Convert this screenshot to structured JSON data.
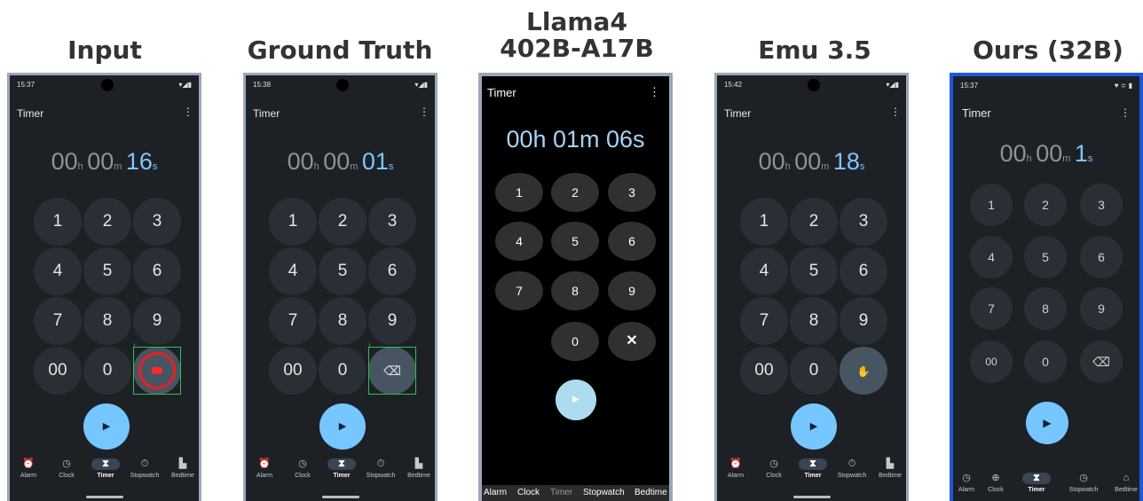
{
  "headings": [
    "Input",
    "Ground Truth",
    "Llama4\n402B-A17B",
    "Emu 3.5",
    "Ours (32B)"
  ],
  "app": {
    "title": "Timer",
    "menu_icon": "⋮",
    "play_icon": "▶",
    "delete_icon": "⌫"
  },
  "units": {
    "h": "h",
    "m": "m",
    "s": "s"
  },
  "keypad": [
    "1",
    "2",
    "3",
    "4",
    "5",
    "6",
    "7",
    "8",
    "9",
    "00",
    "0"
  ],
  "nav": [
    "Alarm",
    "Clock",
    "Timer",
    "Stopwatch",
    "Bedtime"
  ],
  "panels": {
    "input": {
      "time": "15:37",
      "hours": "00",
      "minutes": "00",
      "seconds": "16",
      "marker": "1"
    },
    "truth": {
      "time": "15:38",
      "hours": "00",
      "minutes": "00",
      "seconds": "01",
      "marker": "1"
    },
    "llama": {
      "display": "00h 01m 06s",
      "keys": [
        "1",
        "2",
        "3",
        "4",
        "5",
        "6",
        "7",
        "8",
        "9",
        "0",
        "✕"
      ]
    },
    "emu": {
      "time": "15:42",
      "hours": "00",
      "minutes": "00",
      "seconds": "18"
    },
    "ours": {
      "time": "15:37",
      "hours": "00",
      "minutes": "00",
      "seconds": "1",
      "keys": [
        "1",
        "2",
        "3",
        "4",
        "5",
        "6",
        "7",
        "8",
        "9",
        "00",
        "0"
      ]
    }
  },
  "colors": {
    "accent": "#76c7ff",
    "frame": "#9aa7b8",
    "ours_frame": "#2156e0",
    "tap": "#e61f1f",
    "select": "#2ec24a"
  }
}
